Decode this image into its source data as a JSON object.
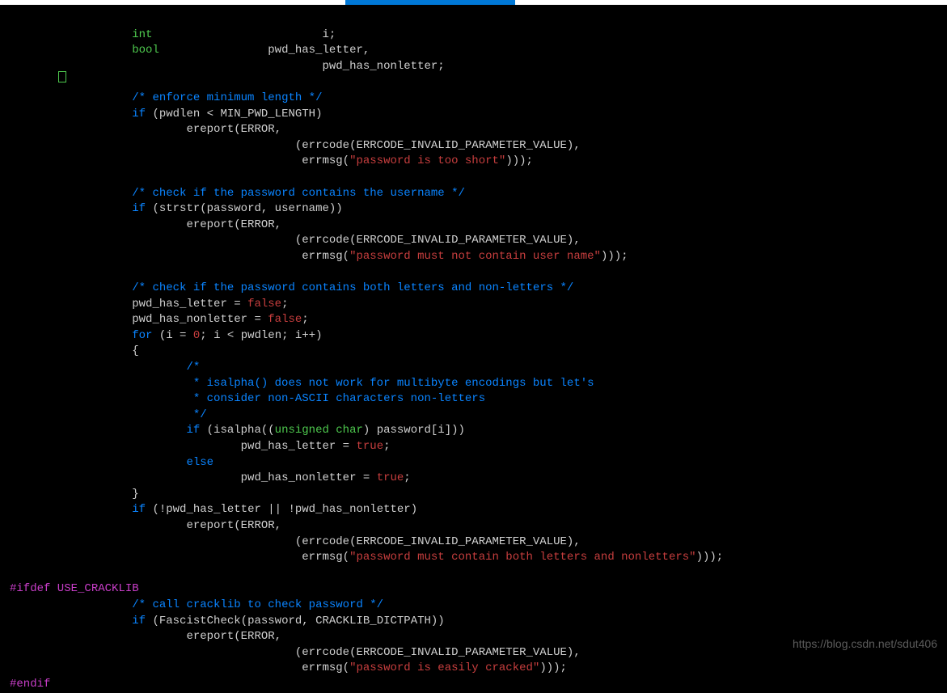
{
  "titlebar": {
    "active": true
  },
  "watermark": "https://blog.csdn.net/sdut406",
  "code": {
    "l1_kw": "int",
    "l1_ident": "i;",
    "l2_kw": "bool",
    "l2_ident": "pwd_has_letter,",
    "l3_ident": "pwd_has_nonletter;",
    "l5_comment": "/* enforce minimum length */",
    "l6_if": "if",
    "l6_rest": " (pwdlen < MIN_PWD_LENGTH)",
    "l7": "ereport(ERROR,",
    "l8": "(errcode(ERRCODE_INVALID_PARAMETER_VALUE),",
    "l9_a": " errmsg(",
    "l9_str": "\"password is too short\"",
    "l9_b": ")));",
    "l11_comment": "/* check if the password contains the username */",
    "l12_if": "if",
    "l12_rest": " (strstr(password, username))",
    "l13": "ereport(ERROR,",
    "l14": "(errcode(ERRCODE_INVALID_PARAMETER_VALUE),",
    "l15_a": " errmsg(",
    "l15_str": "\"password must not contain user name\"",
    "l15_b": ")));",
    "l17_comment": "/* check if the password contains both letters and non-letters */",
    "l18_a": "pwd_has_letter = ",
    "l18_v": "false",
    "l18_b": ";",
    "l19_a": "pwd_has_nonletter = ",
    "l19_v": "false",
    "l19_b": ";",
    "l20_for": "for",
    "l20_a": " (i = ",
    "l20_zero": "0",
    "l20_b": "; i < pwdlen; i++)",
    "l21": "{",
    "l22_c": "/*",
    "l23_c": " * isalpha() does not work for multibyte encodings but let's",
    "l24_c": " * consider non-ASCII characters non-letters",
    "l25_c": " */",
    "l26_if": "if",
    "l26_a": " (isalpha((",
    "l26_uc": "unsigned char",
    "l26_b": ") password[i]))",
    "l27_a": "pwd_has_letter = ",
    "l27_v": "true",
    "l27_b": ";",
    "l28_else": "else",
    "l29_a": "pwd_has_nonletter = ",
    "l29_v": "true",
    "l29_b": ";",
    "l30": "}",
    "l31_if": "if",
    "l31_rest": " (!pwd_has_letter || !pwd_has_nonletter)",
    "l32": "ereport(ERROR,",
    "l33": "(errcode(ERRCODE_INVALID_PARAMETER_VALUE),",
    "l34_a": " errmsg(",
    "l34_str": "\"password must contain both letters and nonletters\"",
    "l34_b": ")));",
    "l36_pp": "#ifdef USE_CRACKLIB",
    "l37_comment": "/* call cracklib to check password */",
    "l38_if": "if",
    "l38_rest": " (FascistCheck(password, CRACKLIB_DICTPATH))",
    "l39": "ereport(ERROR,",
    "l40": "(errcode(ERRCODE_INVALID_PARAMETER_VALUE),",
    "l41_a": " errmsg(",
    "l41_str": "\"password is easily cracked\"",
    "l41_b": ")));",
    "l42_pp": "#endif"
  }
}
